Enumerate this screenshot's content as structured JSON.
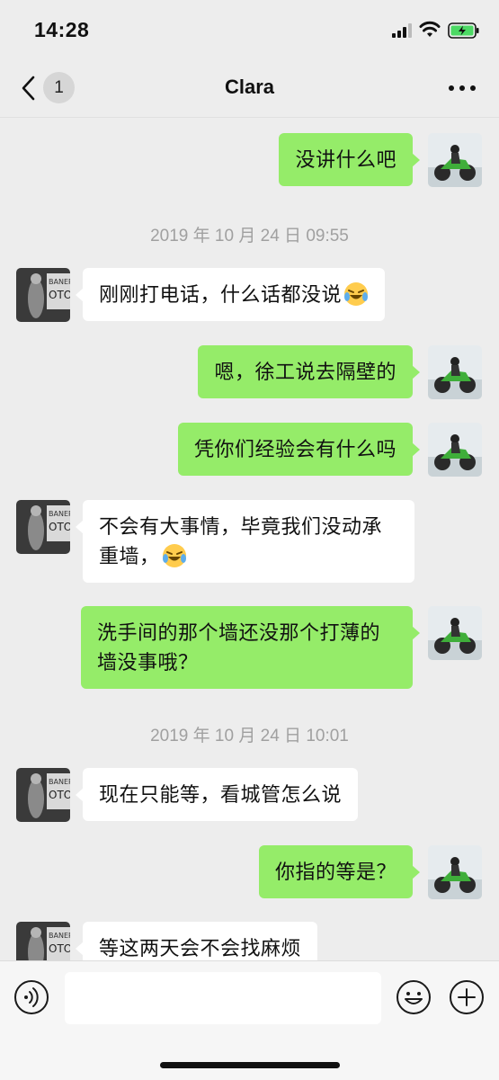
{
  "status_bar": {
    "time": "14:28",
    "icons": [
      "cellular-signal-icon",
      "wifi-icon",
      "battery-charging-icon"
    ]
  },
  "nav": {
    "back_icon": "chevron-left-icon",
    "unread_count": "1",
    "title": "Clara",
    "more_icon": "more-dots-icon"
  },
  "colors": {
    "outgoing_bubble": "#95ec69",
    "incoming_bubble": "#ffffff",
    "background": "#ededed",
    "timestamp_text": "#a0a0a0"
  },
  "messages": [
    {
      "side": "right",
      "text": "没讲什么吧"
    },
    {
      "type": "timestamp",
      "text": "2019 年 10 月 24 日 09:55"
    },
    {
      "side": "left",
      "text": "刚刚打电话，什么话都没说",
      "emoji": "laugh-cry-emoji"
    },
    {
      "side": "right",
      "text": "嗯，徐工说去隔壁的"
    },
    {
      "side": "right",
      "text": "凭你们经验会有什么吗"
    },
    {
      "side": "left",
      "text": "不会有大事情，毕竟我们没动承重墙，",
      "emoji": "laugh-cry-emoji"
    },
    {
      "side": "right",
      "text": "洗手间的那个墙还没那个打薄的墙没事哦？"
    },
    {
      "type": "timestamp",
      "text": "2019 年 10 月 24 日 10:01"
    },
    {
      "side": "left",
      "text": "现在只能等，看城管怎么说"
    },
    {
      "side": "right",
      "text": "你指的等是？"
    },
    {
      "side": "left",
      "text": "等这两天会不会找麻烦"
    }
  ],
  "input_bar": {
    "voice_icon": "voice-input-icon",
    "input_value": "",
    "emoji_icon": "emoji-face-icon",
    "plus_icon": "add-circle-icon"
  }
}
